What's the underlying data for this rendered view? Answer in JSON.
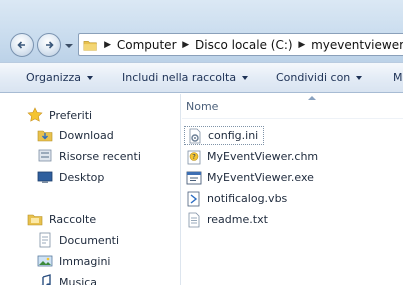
{
  "address": {
    "crumbs": [
      "Computer",
      "Disco locale (C:)",
      "myeventviewer"
    ]
  },
  "toolbar": {
    "organize": "Organizza",
    "include": "Includi nella raccolta",
    "share": "Condividi con",
    "more": "M"
  },
  "nav": {
    "favorites": "Preferiti",
    "download": "Download",
    "recent": "Risorse recenti",
    "desktop": "Desktop",
    "libraries": "Raccolte",
    "documents": "Documenti",
    "images": "Immagini",
    "music": "Musica"
  },
  "filelist": {
    "column_name": "Nome",
    "files": [
      {
        "name": "config.ini",
        "icon": "ini-file-icon"
      },
      {
        "name": "MyEventViewer.chm",
        "icon": "help-file-icon"
      },
      {
        "name": "MyEventViewer.exe",
        "icon": "exe-file-icon"
      },
      {
        "name": "notificalog.vbs",
        "icon": "script-file-icon"
      },
      {
        "name": "readme.txt",
        "icon": "text-file-icon"
      }
    ]
  },
  "colors": {
    "accent": "#1e3256",
    "folder": "#e8c14e"
  }
}
